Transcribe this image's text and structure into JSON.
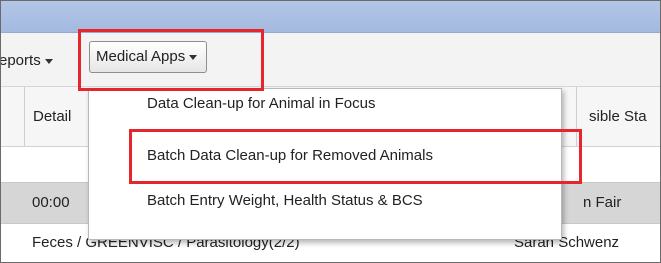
{
  "toolbar": {
    "reports_label": "eports",
    "medical_apps_label": "Medical Apps"
  },
  "grid": {
    "header": {
      "details": "Detail",
      "responsible_status": "sible Sta"
    },
    "rows": [
      {
        "time": "00:00",
        "status": "n Fair"
      },
      {
        "description": "Feces / GREENVISC / Parasitology(2/2)",
        "person": "Sarah Schwenz"
      }
    ]
  },
  "medical_apps_menu": {
    "items": [
      "Data Clean-up for Animal in Focus",
      "Batch Data Clean-up for Removed Animals",
      "Batch Entry Weight, Health Status & BCS"
    ]
  },
  "highlight_color": "#e6262d"
}
